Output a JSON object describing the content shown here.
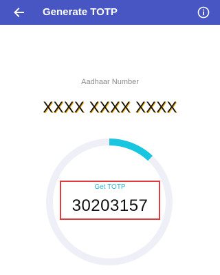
{
  "appbar": {
    "title": "Generate TOTP",
    "back_icon": "arrow-left-icon",
    "info_icon": "info-circle-icon",
    "color": "#4856c4"
  },
  "aadhaar": {
    "label": "Aadhaar Number",
    "value": "XXXX XXXX XXXX"
  },
  "totp": {
    "label": "Get TOTP",
    "code": "30203157",
    "progress_fraction": 0.12,
    "progress_color": "#19c6df",
    "track_color": "#efeff8",
    "highlight_color": "#e23b3b"
  }
}
